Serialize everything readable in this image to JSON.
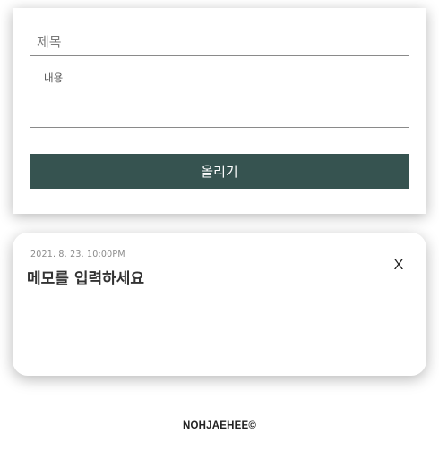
{
  "form": {
    "title_placeholder": "제목",
    "content_placeholder": "내용",
    "submit_label": "올리기"
  },
  "memo": {
    "date": "2021. 8. 23. 10:00PM",
    "title": "메모를 입력하세요",
    "delete_label": "X"
  },
  "footer": {
    "credit": "NOHJAEHEE©"
  }
}
